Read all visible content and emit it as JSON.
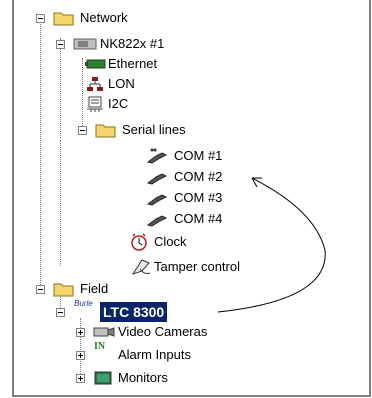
{
  "tree": {
    "network": "Network",
    "device": "NK822x #1",
    "ethernet": "Ethernet",
    "lon": "LON",
    "i2c": "I2C",
    "serial_lines": "Serial lines",
    "com1": "COM #1",
    "com2": "COM #2",
    "com3": "COM #3",
    "com4": "COM #4",
    "clock": "Clock",
    "tamper": "Tamper control",
    "field": "Field",
    "ltc": "LTC 8300",
    "ltc_icon_text": "Burle",
    "video_cameras": "Video Cameras",
    "alarm_inputs": "Alarm Inputs",
    "alarm_icon_text": "IN",
    "monitors": "Monitors"
  },
  "colors": {
    "selection": "#0a246a",
    "folder": "#f5d66a",
    "annotation_line": "#000000"
  }
}
